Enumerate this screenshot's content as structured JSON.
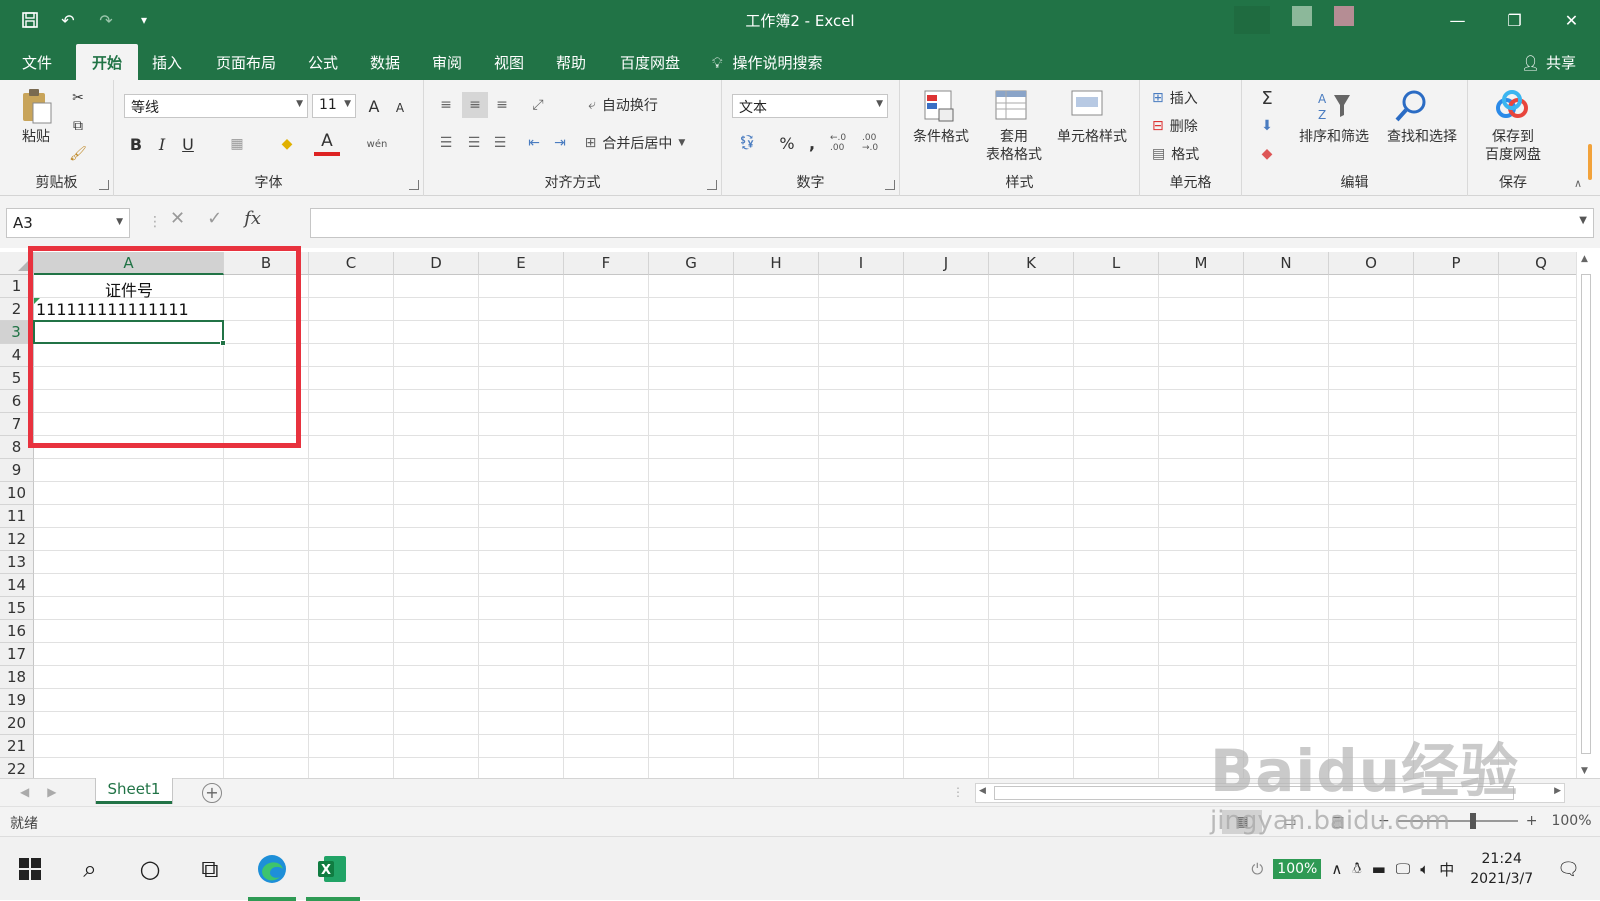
{
  "window": {
    "title": "工作簿2  -  Excel",
    "qat": {
      "save_icon": "save-icon",
      "undo_icon": "undo-icon",
      "redo_icon": "redo-icon",
      "customize": "▾"
    },
    "controls": {
      "minimize": "—",
      "restore": "❐",
      "close": "✕"
    }
  },
  "tabs": [
    {
      "label": "文件"
    },
    {
      "label": "开始",
      "active": true
    },
    {
      "label": "插入"
    },
    {
      "label": "页面布局"
    },
    {
      "label": "公式"
    },
    {
      "label": "数据"
    },
    {
      "label": "审阅"
    },
    {
      "label": "视图"
    },
    {
      "label": "帮助"
    },
    {
      "label": "百度网盘"
    }
  ],
  "tell_me": "操作说明搜索",
  "share": "共享",
  "ribbon": {
    "clipboard": {
      "label": "剪贴板",
      "paste": "粘贴"
    },
    "font": {
      "label": "字体",
      "font_name": "等线",
      "font_size": "11",
      "bold": "B",
      "italic": "I",
      "underline": "U",
      "increase": "A",
      "decrease": "A",
      "phonetic": "wén"
    },
    "alignment": {
      "label": "对齐方式",
      "wrap_text": "自动换行",
      "merge_center": "合并后居中"
    },
    "number": {
      "label": "数字",
      "format": "文本",
      "percent": "%",
      "comma": ",",
      "inc_decimal": "←.0 .00",
      "dec_decimal": ".00 →.0"
    },
    "styles": {
      "label": "样式",
      "conditional": "条件格式",
      "table_line1": "套用",
      "table_line2": "表格格式",
      "cell_styles": "单元格样式"
    },
    "cells": {
      "label": "单元格",
      "insert": "插入",
      "delete": "删除",
      "format": "格式"
    },
    "editing": {
      "label": "编辑",
      "sum": "Σ",
      "sort_filter": "排序和筛选",
      "find_select": "查找和选择"
    },
    "save": {
      "label": "保存",
      "save_to_line1": "保存到",
      "save_to_line2": "百度网盘"
    }
  },
  "formula_bar": {
    "name_box": "A3",
    "cancel": "✕",
    "enter": "✓",
    "fx": "fx",
    "value": ""
  },
  "grid": {
    "columns": [
      "A",
      "B",
      "C",
      "D",
      "E",
      "F",
      "G",
      "H",
      "I",
      "J",
      "K",
      "L",
      "M",
      "N",
      "O",
      "P",
      "Q"
    ],
    "rows": [
      "1",
      "2",
      "3",
      "4",
      "5",
      "6",
      "7",
      "8",
      "9",
      "10",
      "11",
      "12",
      "13",
      "14",
      "15",
      "16",
      "17",
      "18",
      "19",
      "20",
      "21",
      "22"
    ],
    "selected_col": "A",
    "selected_row": "3",
    "cells": {
      "A1": "证件号",
      "A2": "111111111111111"
    }
  },
  "sheets": {
    "tabs": [
      "Sheet1"
    ],
    "add": "+"
  },
  "status": {
    "ready": "就绪",
    "zoom": "100%",
    "zoom_minus": "−",
    "zoom_plus": "+"
  },
  "taskbar": {
    "battery": "100%",
    "ime": "中",
    "time": "21:24",
    "date": "2021/3/7"
  },
  "watermark": {
    "main": "Baidu经验",
    "sub": "jingyan.baidu.com"
  },
  "colors": {
    "excel_green": "#217346",
    "highlight_red": "#e8323e"
  }
}
